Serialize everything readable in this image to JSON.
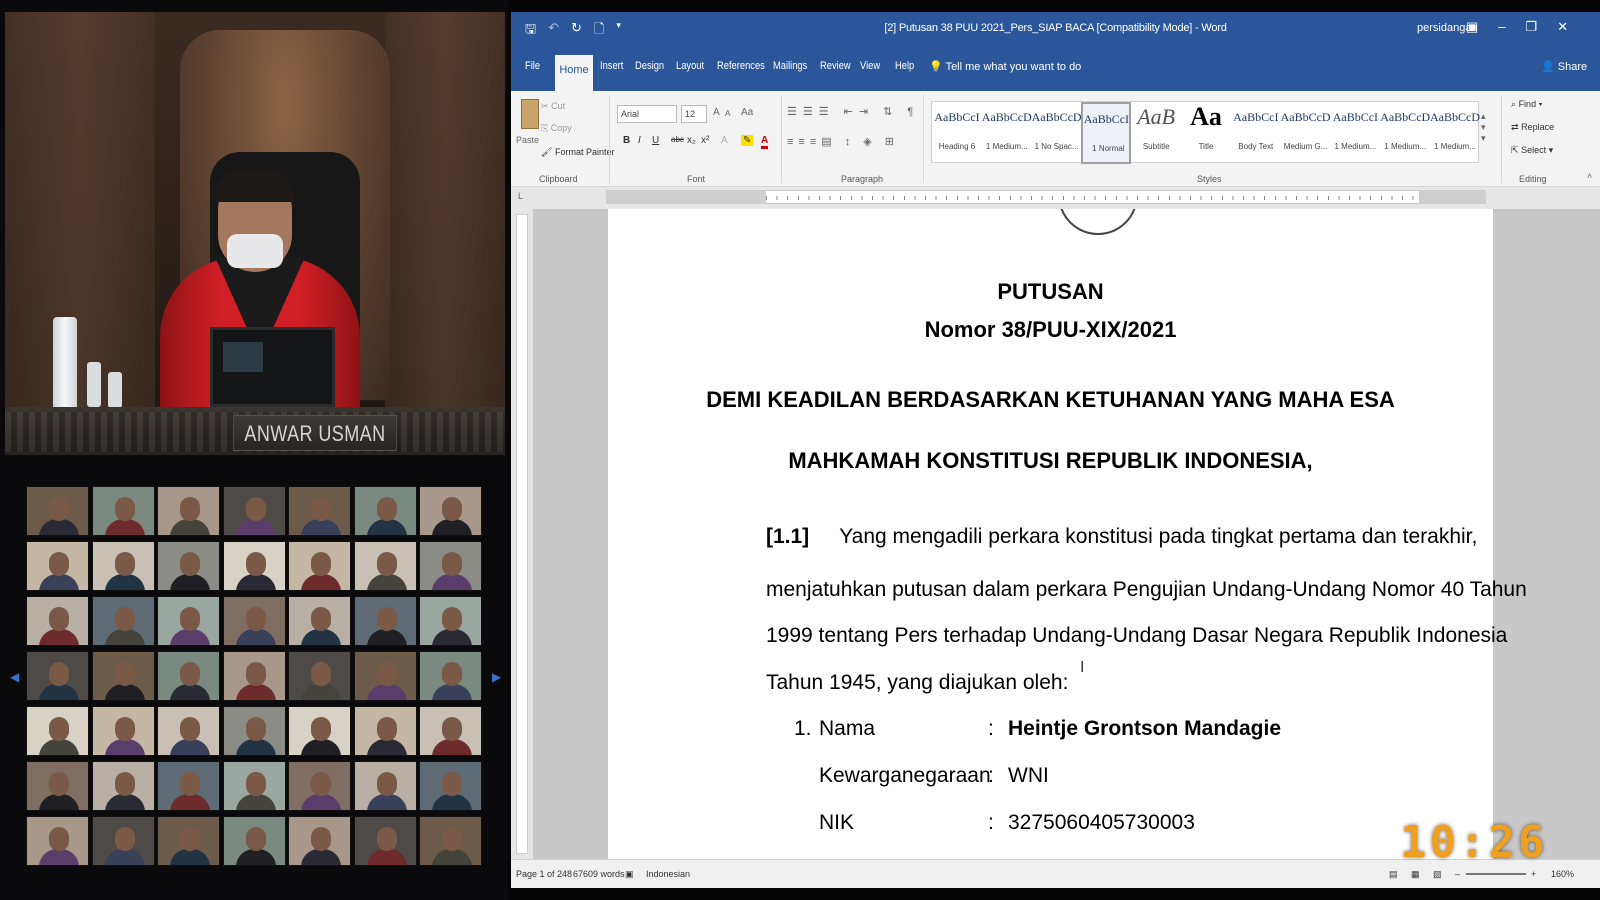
{
  "video": {
    "nameplate": "ANWAR USMAN"
  },
  "gallery": {
    "prev_icon": "chevron-left-icon",
    "next_icon": "chevron-right-icon"
  },
  "word": {
    "qat": {
      "save": "🖫",
      "undo": "↶",
      "redo": "↻",
      "new": "🗋",
      "more": "▾"
    },
    "title": "[2] Putusan 38 PUU 2021_Pers_SIAP BACA [Compatibility Mode] - Word",
    "user": "persidangan",
    "controls": {
      "ribbon_opts": "▣",
      "minimize": "–",
      "restore": "❐",
      "close": "✕"
    },
    "tabs": [
      "File",
      "Home",
      "Insert",
      "Design",
      "Layout",
      "References",
      "Mailings",
      "Review",
      "View",
      "Help"
    ],
    "tell_me": "Tell me what you want to do",
    "share": "Share",
    "clipboard": {
      "paste": "Paste",
      "cut": "Cut",
      "copy": "Copy",
      "format_painter": "Format Painter",
      "label": "Clipboard"
    },
    "font": {
      "name": "Arial",
      "size": "12",
      "label": "Font",
      "grow": "A",
      "shrink": "A",
      "case": "Aa",
      "bold": "B",
      "italic": "I",
      "underline": "U",
      "strike": "abc",
      "sub": "x₂",
      "sup": "x²"
    },
    "paragraph": {
      "label": "Paragraph"
    },
    "styles": {
      "label": "Styles",
      "items": [
        {
          "preview": "AaBbCcI",
          "name": "Heading 6"
        },
        {
          "preview": "AaBbCcD",
          "name": "1 Medium..."
        },
        {
          "preview": "AaBbCcD",
          "name": "1 No Spac..."
        },
        {
          "preview": "AaBbCcI",
          "name": "1 Normal"
        },
        {
          "preview": "AaB",
          "name": "Subtitle"
        },
        {
          "preview": "Aa",
          "name": "Title"
        },
        {
          "preview": "AaBbCcI",
          "name": "Body Text"
        },
        {
          "preview": "AaBbCcD",
          "name": "Medium G..."
        },
        {
          "preview": "AaBbCcI",
          "name": "1 Medium..."
        },
        {
          "preview": "AaBbCcD",
          "name": "1 Medium..."
        },
        {
          "preview": "AaBbCcD",
          "name": "1 Medium..."
        }
      ]
    },
    "editing": {
      "find": "Find",
      "replace": "Replace",
      "select": "Select",
      "label": "Editing"
    },
    "ruler_tab": "L",
    "document": {
      "title": "PUTUSAN",
      "number": "Nomor 38/PUU-XIX/2021",
      "heading1": "DEMI KEADILAN BERDASARKAN KETUHANAN YANG MAHA ESA",
      "heading2": "MAHKAMAH KONSTITUSI REPUBLIK INDONESIA,",
      "para_num": "[1.1]",
      "line1": "Yang mengadili perkara konstitusi pada tingkat pertama dan terakhir,",
      "line2": "menjatuhkan putusan dalam perkara Pengujian Undang-Undang Nomor 40 Tahun",
      "line3": "1999 tentang Pers terhadap Undang-Undang Dasar Negara Republik Indonesia",
      "line4": "Tahun 1945, yang diajukan oleh:",
      "item_num": "1.",
      "fields": [
        {
          "label": "Nama",
          "value": "Heintje Grontson Mandagie"
        },
        {
          "label": "Kewarganegaraan",
          "value": "WNI"
        },
        {
          "label": "NIK",
          "value": "3275060405730003"
        }
      ],
      "colon": ":"
    },
    "status": {
      "page": "Page 1 of 248",
      "words": "67609 words",
      "language": "Indonesian",
      "zoom": "160%"
    }
  },
  "clock": "10:26"
}
